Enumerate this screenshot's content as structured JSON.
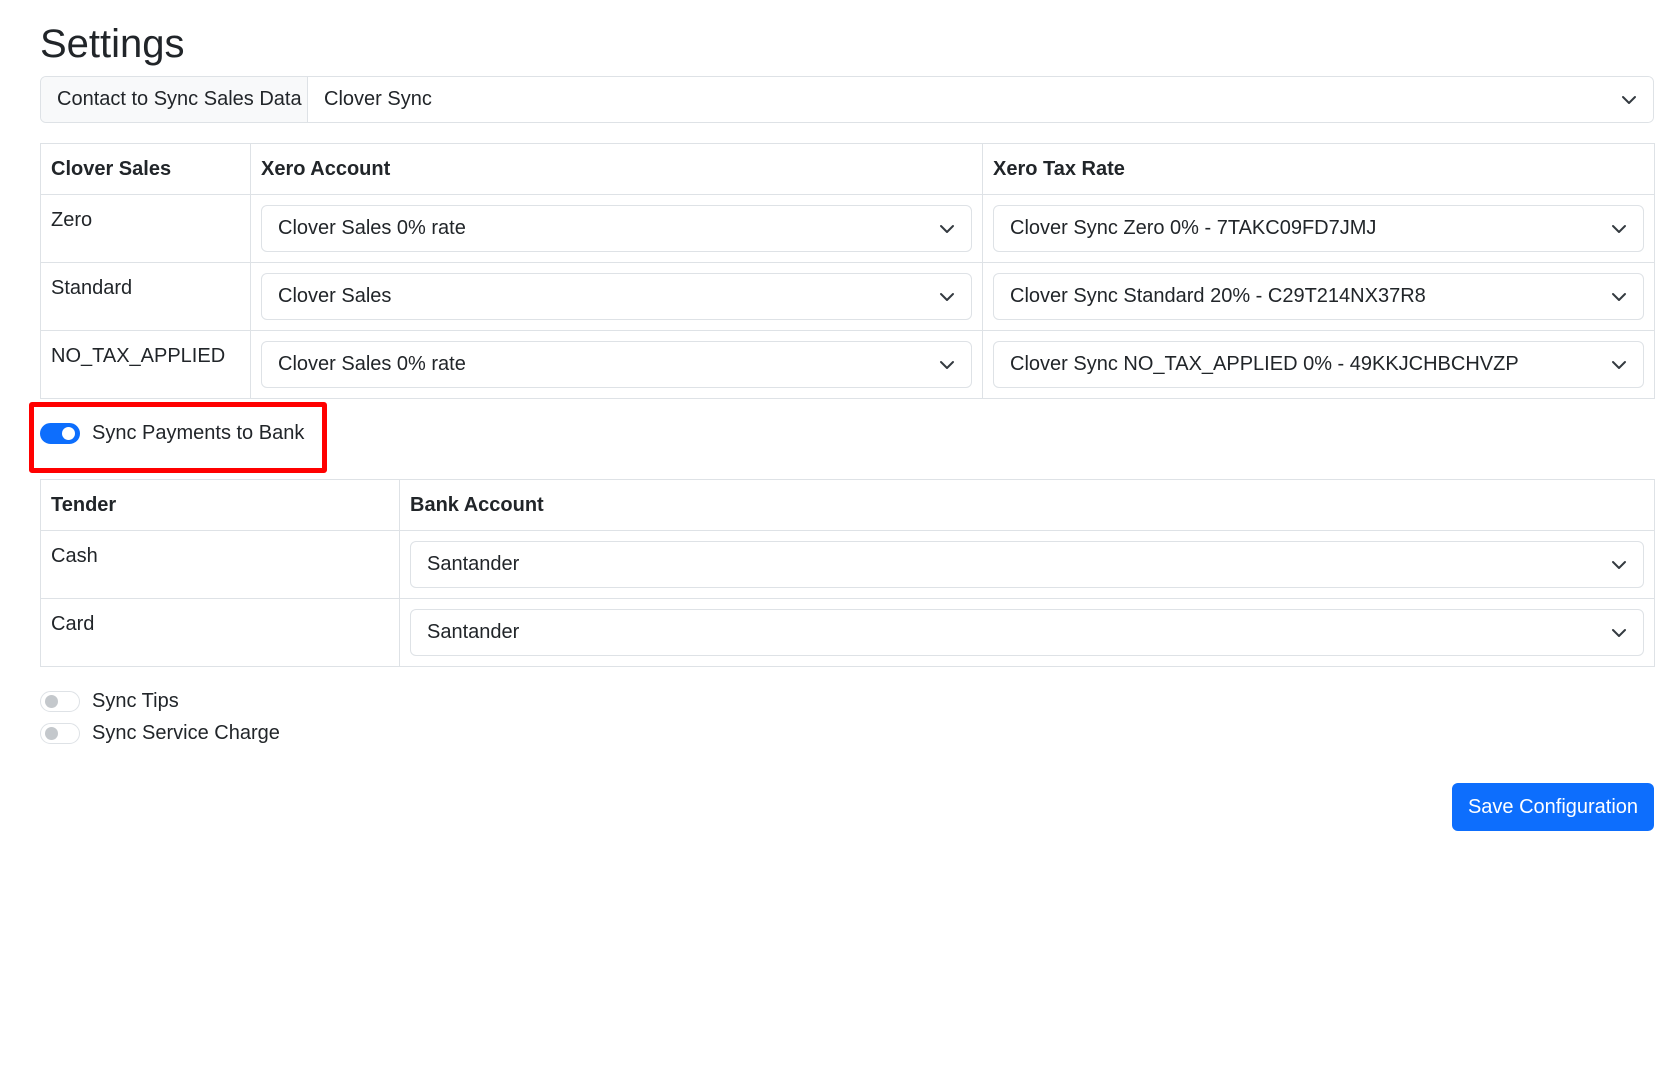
{
  "page": {
    "title": "Settings"
  },
  "contact": {
    "label": "Contact to Sync Sales Data",
    "value": "Clover Sync"
  },
  "sales_table": {
    "headers": [
      "Clover Sales",
      "Xero Account",
      "Xero Tax Rate"
    ],
    "rows": [
      {
        "type": "Zero",
        "account": "Clover Sales 0% rate",
        "tax": "Clover Sync Zero 0% - 7TAKC09FD7JMJ"
      },
      {
        "type": "Standard",
        "account": "Clover Sales",
        "tax": "Clover Sync Standard 20% - C29T214NX37R8"
      },
      {
        "type": "NO_TAX_APPLIED",
        "account": "Clover Sales 0% rate",
        "tax": "Clover Sync NO_TAX_APPLIED 0% - 49KKJCHBCHVZP"
      }
    ]
  },
  "sync_payments": {
    "label": "Sync Payments to Bank",
    "checked": true
  },
  "tender_table": {
    "headers": [
      "Tender",
      "Bank Account"
    ],
    "rows": [
      {
        "tender": "Cash",
        "bank": "Santander"
      },
      {
        "tender": "Card",
        "bank": "Santander"
      }
    ]
  },
  "sync_tips": {
    "label": "Sync Tips",
    "checked": false
  },
  "sync_service_charge": {
    "label": "Sync Service Charge",
    "checked": false
  },
  "save": {
    "label": "Save Configuration"
  },
  "colors": {
    "primary": "#0d6efd",
    "highlight": "#ff0000",
    "border": "#dee2e6"
  }
}
